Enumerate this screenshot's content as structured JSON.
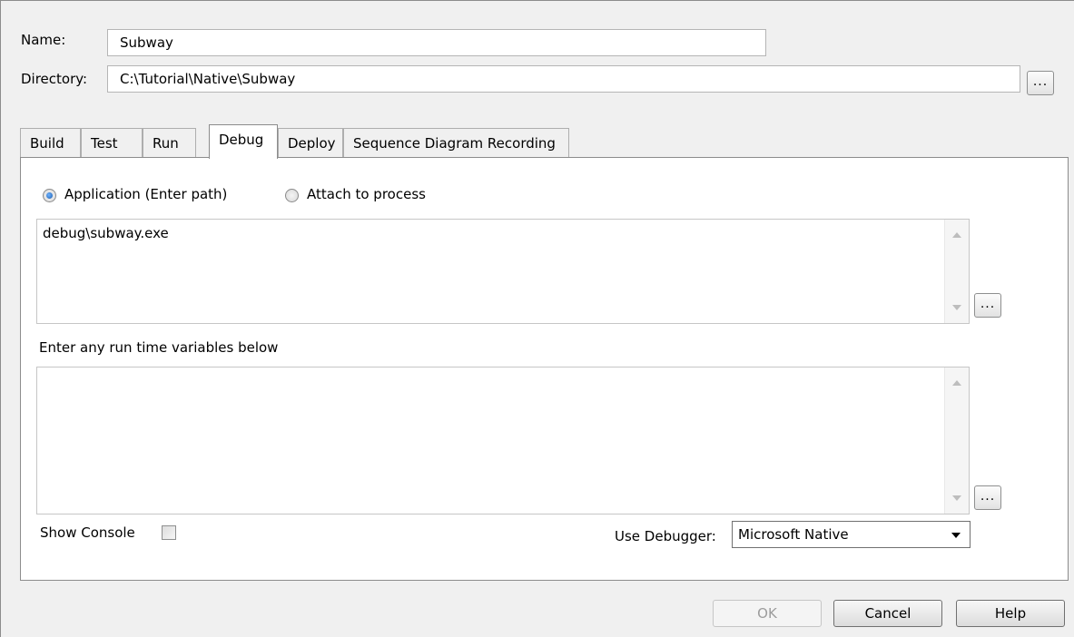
{
  "form": {
    "name_label": "Name:",
    "name_value": "Subway",
    "directory_label": "Directory:",
    "directory_value": "C:\\Tutorial\\Native\\Subway",
    "browse_label": "..."
  },
  "tabs": [
    {
      "label": "Build",
      "active": false
    },
    {
      "label": "Test",
      "active": false
    },
    {
      "label": "Run",
      "active": false
    },
    {
      "label": "Debug",
      "active": true
    },
    {
      "label": "Deploy",
      "active": false
    },
    {
      "label": "Sequence Diagram Recording",
      "active": false
    }
  ],
  "debug": {
    "radio_application_label": "Application (Enter path)",
    "radio_application_selected": true,
    "radio_attach_label": "Attach to process",
    "radio_attach_selected": false,
    "application_path": "debug\\subway.exe",
    "browse_label": "...",
    "runtime_vars_label": "Enter any run time variables below",
    "runtime_vars_value": "",
    "runtime_browse_label": "...",
    "show_console_label": "Show Console",
    "show_console_checked": false,
    "use_debugger_label": "Use Debugger:",
    "debugger_selected": "Microsoft Native"
  },
  "buttons": {
    "ok": "OK",
    "ok_enabled": false,
    "cancel": "Cancel",
    "help": "Help"
  },
  "colors": {
    "window_bg": "#f0f0f0",
    "panel_bg": "#ffffff",
    "radio_selected": "#1b5cad"
  },
  "icons": {
    "scroll_up": "scroll-up-arrow-icon",
    "scroll_down": "scroll-down-arrow-icon",
    "dropdown": "chevron-down-icon",
    "radio_on": "radio-selected-icon",
    "radio_off": "radio-unselected-icon"
  }
}
